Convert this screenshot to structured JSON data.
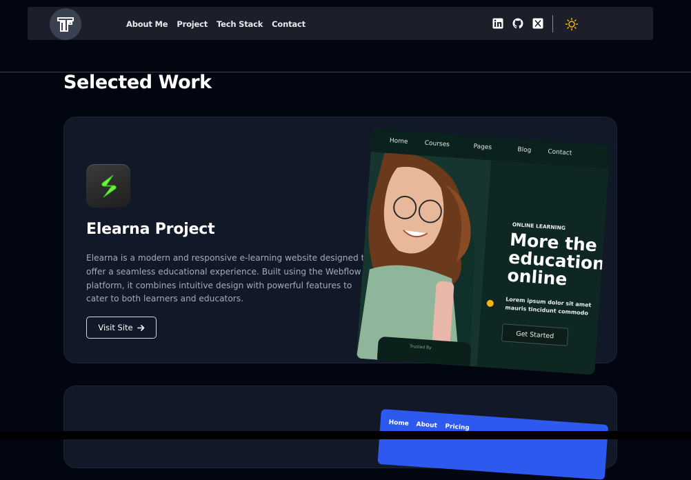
{
  "nav": {
    "links": [
      "About Me",
      "Project",
      "Tech Stack",
      "Contact"
    ],
    "social_icons": [
      "linkedin-icon",
      "github-icon",
      "x-twitter-icon"
    ],
    "theme_icon": "sun-icon",
    "logo_icon": "tt-logo-icon"
  },
  "section": {
    "title": "Selected Work"
  },
  "projects": [
    {
      "title": "Elearna Project",
      "description": "Elearna is a modern and responsive e-learning website designed to offer a seamless educational experience. Built using the Webflow platform, it combines intuitive design with powerful features to cater to both learners and educators.",
      "button_label": "Visit Site",
      "icon": "elearna-app-icon",
      "mockup": {
        "nav_items": [
          "Home",
          "Courses",
          "Pages",
          "Blog",
          "Contact"
        ],
        "label": "ONLINE LEARNING",
        "headline": "More the\neducation\nonline",
        "lorem": "Lorem ipsum dolor sit amet\nmauris tincidunt commodo",
        "cta": "Get Started",
        "badge_text": "Trusted By"
      }
    },
    {
      "mockup": {
        "nav_items": [
          "Home",
          "About",
          "Pricing"
        ]
      }
    }
  ],
  "colors": {
    "background": "#020611",
    "navbar": "#1c1f2a",
    "card": "#111827",
    "mockup_green": "#0f2722",
    "accent_yellow": "#f4b513",
    "icon_green": "#6df23a",
    "mockup2_blue": "#2d59ef"
  }
}
